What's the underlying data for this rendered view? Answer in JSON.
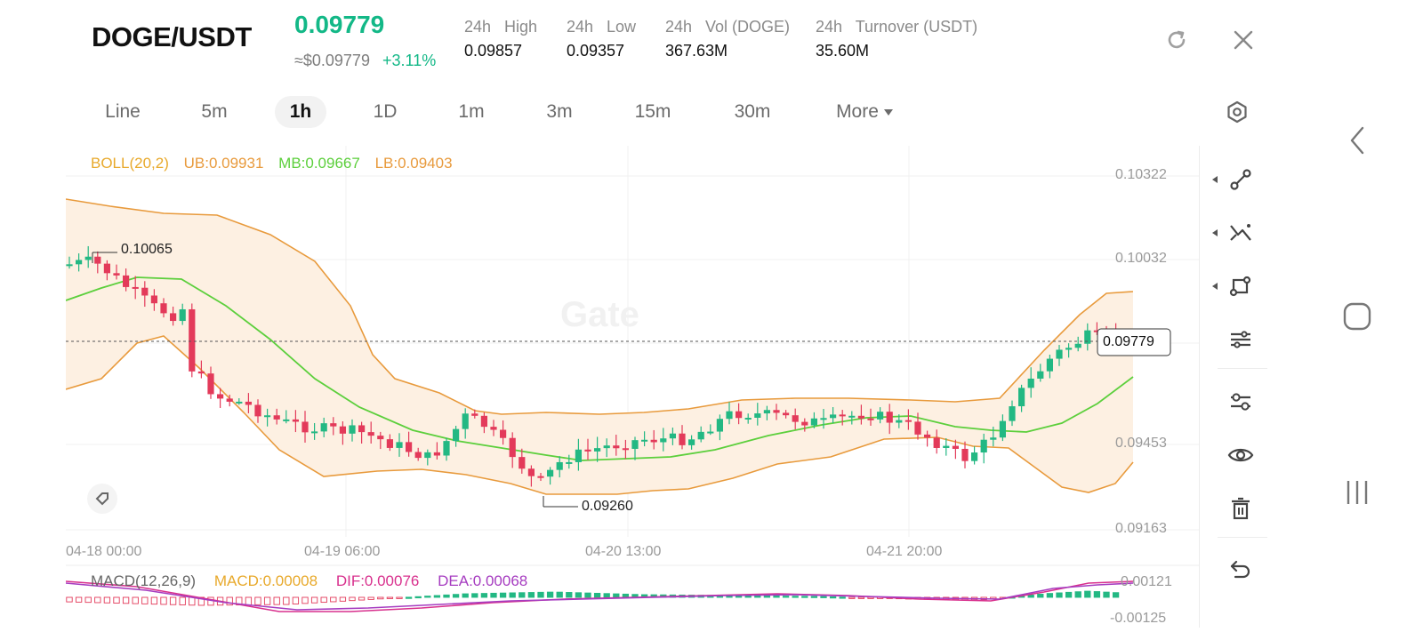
{
  "header": {
    "pair": "DOGE/USDT",
    "last_price": "0.09779",
    "usd_price": "≈$0.09779",
    "change_pct": "+3.11%",
    "stats": [
      {
        "label": "24h   High",
        "value": "0.09857"
      },
      {
        "label": "24h   Low",
        "value": "0.09357"
      },
      {
        "label": "24h   Vol (DOGE)",
        "value": "367.63M"
      },
      {
        "label": "24h   Turnover (USDT)",
        "value": "35.60M"
      }
    ],
    "icons": [
      "refresh-icon",
      "close-icon"
    ]
  },
  "timeframes": {
    "items": [
      "Line",
      "5m",
      "1h",
      "1D",
      "1m",
      "3m",
      "15m",
      "30m",
      "More"
    ],
    "active": "1h"
  },
  "indicators": {
    "boll": {
      "name": "BOLL(20,2)",
      "ub": "UB:0.09931",
      "mb": "MB:0.09667",
      "lb": "LB:0.09403"
    },
    "macd": {
      "name": "MACD(12,26,9)",
      "macd": "MACD:0.00008",
      "dif": "DIF:0.00076",
      "dea": "DEA:0.00068"
    }
  },
  "chart_data": {
    "type": "candlestick",
    "y_axis_labels": [
      "0.10322",
      "0.10032",
      "0.09453",
      "0.09163"
    ],
    "ylim": [
      0.09163,
      0.10322
    ],
    "x_axis_labels": [
      "04-18 00:00",
      "04-19 06:00",
      "04-20 13:00",
      "04-21 20:00"
    ],
    "high_marker": "0.10065",
    "low_marker": "0.09260",
    "current_price_tag": "0.09779",
    "watermark": "Gate",
    "macd_axis_labels": [
      "0.00121",
      "-0.00125"
    ],
    "colors": {
      "up": "#23b883",
      "down": "#e33a5a",
      "ub_lb": "#e89a3c",
      "mb": "#5ccf3c",
      "band_fill": "#fdf0e2",
      "dif": "#d8308d",
      "dea": "#a63cc0"
    }
  },
  "toolbar": {
    "tools": [
      "line-tool-icon",
      "trend-tool-icon",
      "shape-tool-icon",
      "settings-sliders-icon",
      "indicator-settings-icon",
      "visibility-icon",
      "delete-icon",
      "undo-icon"
    ]
  },
  "system_nav": [
    "back-nav-icon",
    "home-nav-icon",
    "recents-nav-icon"
  ]
}
